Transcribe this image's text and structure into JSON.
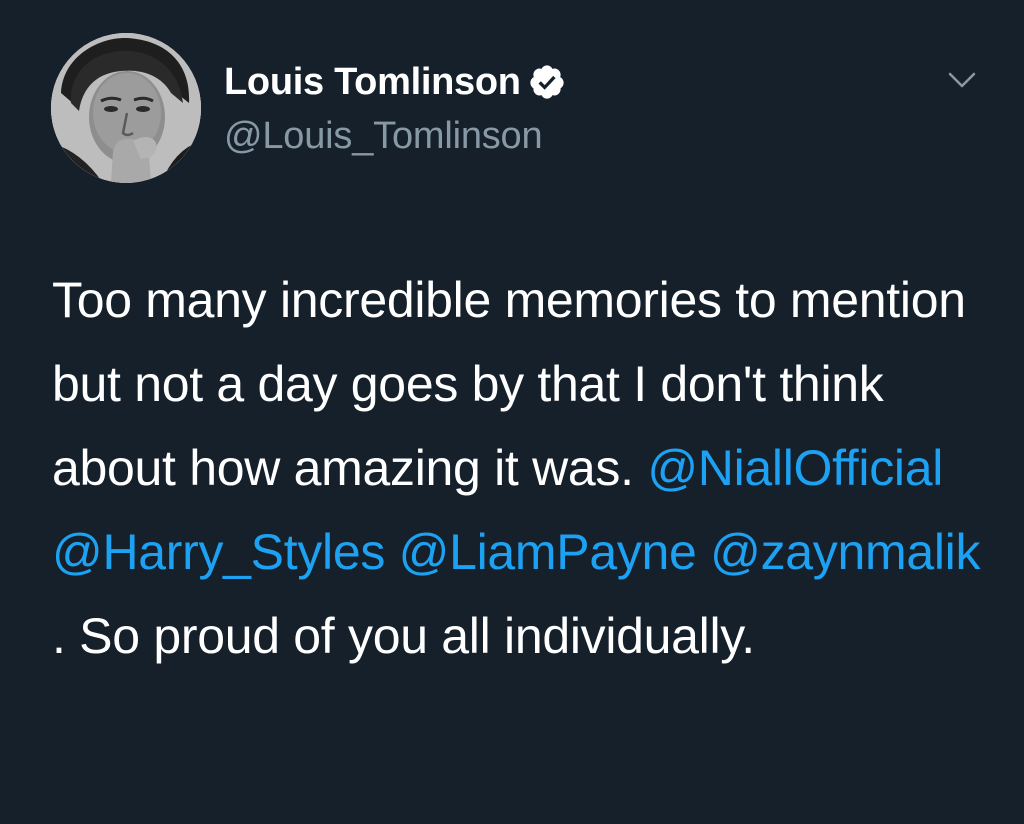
{
  "author": {
    "display_name": "Louis Tomlinson",
    "handle": "@Louis_Tomlinson",
    "verified": true,
    "avatar_icon": "profile-photo"
  },
  "menu": {
    "icon": "chevron-down-icon"
  },
  "tweet": {
    "text_before_mentions": "Too many incredible memories to mention but not a day goes by that I don't think about how amazing it was.",
    "mentions": [
      "@NiallOfficial",
      "@Harry_Styles",
      "@LiamPayne",
      "@zaynmalik"
    ],
    "text_after_mentions": ". So proud of you all individually."
  },
  "colors": {
    "background": "#15202b",
    "text": "#ffffff",
    "secondary_text": "#8899a6",
    "mention": "#1da1f2",
    "verified_badge": "#ffffff"
  }
}
